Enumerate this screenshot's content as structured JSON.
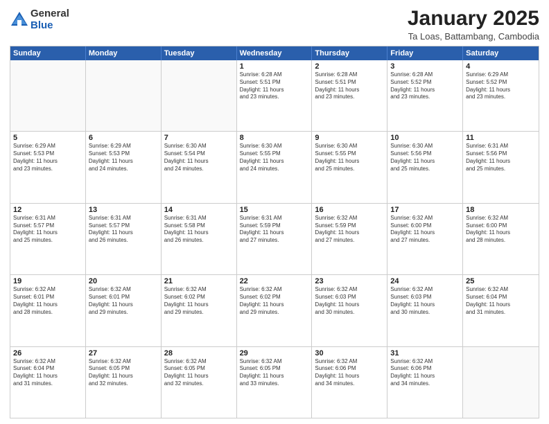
{
  "logo": {
    "general": "General",
    "blue": "Blue"
  },
  "title": "January 2025",
  "subtitle": "Ta Loas, Battambang, Cambodia",
  "header": {
    "days": [
      "Sunday",
      "Monday",
      "Tuesday",
      "Wednesday",
      "Thursday",
      "Friday",
      "Saturday"
    ]
  },
  "weeks": [
    [
      {
        "day": "",
        "info": "",
        "empty": true
      },
      {
        "day": "",
        "info": "",
        "empty": true
      },
      {
        "day": "",
        "info": "",
        "empty": true
      },
      {
        "day": "1",
        "info": "Sunrise: 6:28 AM\nSunset: 5:51 PM\nDaylight: 11 hours\nand 23 minutes.",
        "empty": false
      },
      {
        "day": "2",
        "info": "Sunrise: 6:28 AM\nSunset: 5:51 PM\nDaylight: 11 hours\nand 23 minutes.",
        "empty": false
      },
      {
        "day": "3",
        "info": "Sunrise: 6:28 AM\nSunset: 5:52 PM\nDaylight: 11 hours\nand 23 minutes.",
        "empty": false
      },
      {
        "day": "4",
        "info": "Sunrise: 6:29 AM\nSunset: 5:52 PM\nDaylight: 11 hours\nand 23 minutes.",
        "empty": false
      }
    ],
    [
      {
        "day": "5",
        "info": "Sunrise: 6:29 AM\nSunset: 5:53 PM\nDaylight: 11 hours\nand 23 minutes.",
        "empty": false
      },
      {
        "day": "6",
        "info": "Sunrise: 6:29 AM\nSunset: 5:53 PM\nDaylight: 11 hours\nand 24 minutes.",
        "empty": false
      },
      {
        "day": "7",
        "info": "Sunrise: 6:30 AM\nSunset: 5:54 PM\nDaylight: 11 hours\nand 24 minutes.",
        "empty": false
      },
      {
        "day": "8",
        "info": "Sunrise: 6:30 AM\nSunset: 5:55 PM\nDaylight: 11 hours\nand 24 minutes.",
        "empty": false
      },
      {
        "day": "9",
        "info": "Sunrise: 6:30 AM\nSunset: 5:55 PM\nDaylight: 11 hours\nand 25 minutes.",
        "empty": false
      },
      {
        "day": "10",
        "info": "Sunrise: 6:30 AM\nSunset: 5:56 PM\nDaylight: 11 hours\nand 25 minutes.",
        "empty": false
      },
      {
        "day": "11",
        "info": "Sunrise: 6:31 AM\nSunset: 5:56 PM\nDaylight: 11 hours\nand 25 minutes.",
        "empty": false
      }
    ],
    [
      {
        "day": "12",
        "info": "Sunrise: 6:31 AM\nSunset: 5:57 PM\nDaylight: 11 hours\nand 25 minutes.",
        "empty": false
      },
      {
        "day": "13",
        "info": "Sunrise: 6:31 AM\nSunset: 5:57 PM\nDaylight: 11 hours\nand 26 minutes.",
        "empty": false
      },
      {
        "day": "14",
        "info": "Sunrise: 6:31 AM\nSunset: 5:58 PM\nDaylight: 11 hours\nand 26 minutes.",
        "empty": false
      },
      {
        "day": "15",
        "info": "Sunrise: 6:31 AM\nSunset: 5:59 PM\nDaylight: 11 hours\nand 27 minutes.",
        "empty": false
      },
      {
        "day": "16",
        "info": "Sunrise: 6:32 AM\nSunset: 5:59 PM\nDaylight: 11 hours\nand 27 minutes.",
        "empty": false
      },
      {
        "day": "17",
        "info": "Sunrise: 6:32 AM\nSunset: 6:00 PM\nDaylight: 11 hours\nand 27 minutes.",
        "empty": false
      },
      {
        "day": "18",
        "info": "Sunrise: 6:32 AM\nSunset: 6:00 PM\nDaylight: 11 hours\nand 28 minutes.",
        "empty": false
      }
    ],
    [
      {
        "day": "19",
        "info": "Sunrise: 6:32 AM\nSunset: 6:01 PM\nDaylight: 11 hours\nand 28 minutes.",
        "empty": false
      },
      {
        "day": "20",
        "info": "Sunrise: 6:32 AM\nSunset: 6:01 PM\nDaylight: 11 hours\nand 29 minutes.",
        "empty": false
      },
      {
        "day": "21",
        "info": "Sunrise: 6:32 AM\nSunset: 6:02 PM\nDaylight: 11 hours\nand 29 minutes.",
        "empty": false
      },
      {
        "day": "22",
        "info": "Sunrise: 6:32 AM\nSunset: 6:02 PM\nDaylight: 11 hours\nand 29 minutes.",
        "empty": false
      },
      {
        "day": "23",
        "info": "Sunrise: 6:32 AM\nSunset: 6:03 PM\nDaylight: 11 hours\nand 30 minutes.",
        "empty": false
      },
      {
        "day": "24",
        "info": "Sunrise: 6:32 AM\nSunset: 6:03 PM\nDaylight: 11 hours\nand 30 minutes.",
        "empty": false
      },
      {
        "day": "25",
        "info": "Sunrise: 6:32 AM\nSunset: 6:04 PM\nDaylight: 11 hours\nand 31 minutes.",
        "empty": false
      }
    ],
    [
      {
        "day": "26",
        "info": "Sunrise: 6:32 AM\nSunset: 6:04 PM\nDaylight: 11 hours\nand 31 minutes.",
        "empty": false
      },
      {
        "day": "27",
        "info": "Sunrise: 6:32 AM\nSunset: 6:05 PM\nDaylight: 11 hours\nand 32 minutes.",
        "empty": false
      },
      {
        "day": "28",
        "info": "Sunrise: 6:32 AM\nSunset: 6:05 PM\nDaylight: 11 hours\nand 32 minutes.",
        "empty": false
      },
      {
        "day": "29",
        "info": "Sunrise: 6:32 AM\nSunset: 6:05 PM\nDaylight: 11 hours\nand 33 minutes.",
        "empty": false
      },
      {
        "day": "30",
        "info": "Sunrise: 6:32 AM\nSunset: 6:06 PM\nDaylight: 11 hours\nand 34 minutes.",
        "empty": false
      },
      {
        "day": "31",
        "info": "Sunrise: 6:32 AM\nSunset: 6:06 PM\nDaylight: 11 hours\nand 34 minutes.",
        "empty": false
      },
      {
        "day": "",
        "info": "",
        "empty": true
      }
    ]
  ]
}
